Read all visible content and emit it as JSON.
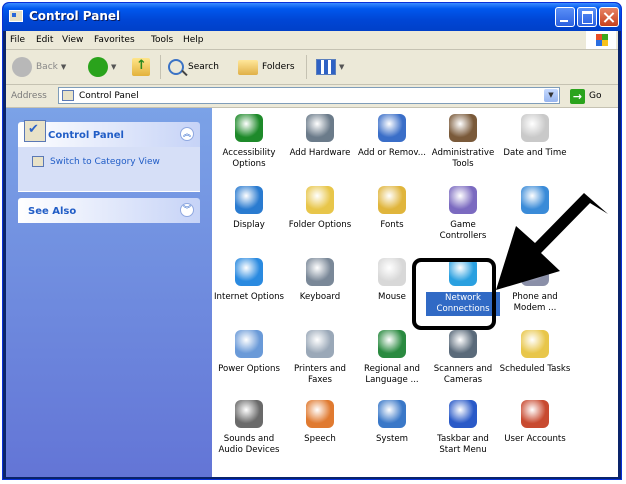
{
  "window": {
    "title": "Control Panel"
  },
  "menu": [
    "File",
    "Edit",
    "View",
    "Favorites",
    "Tools",
    "Help"
  ],
  "toolbar": {
    "back_label": "Back",
    "search_label": "Search",
    "folders_label": "Folders"
  },
  "address": {
    "label": "Address",
    "value": "Control Panel",
    "go_label": "Go"
  },
  "taskpane": {
    "control_panel_title": "Control Panel",
    "switch_link": "Switch to Category View",
    "see_also_title": "See Also"
  },
  "items": [
    {
      "label": "Accessibility Options",
      "icon": "accessibility-icon"
    },
    {
      "label": "Add Hardware",
      "icon": "add-hardware-icon"
    },
    {
      "label": "Add or Remov...",
      "icon": "add-remove-icon"
    },
    {
      "label": "Administrative Tools",
      "icon": "administrative-tools-icon"
    },
    {
      "label": "Date and Time",
      "icon": "date-time-icon"
    },
    {
      "label": "Display",
      "icon": "display-icon"
    },
    {
      "label": "Folder Options",
      "icon": "folder-options-icon"
    },
    {
      "label": "Fonts",
      "icon": "fonts-icon"
    },
    {
      "label": "Game Controllers",
      "icon": "game-controllers-icon"
    },
    {
      "label": "",
      "icon": "internet-options-partial-icon"
    },
    {
      "label": "Internet Options",
      "icon": "internet-options-icon"
    },
    {
      "label": "Keyboard",
      "icon": "keyboard-icon"
    },
    {
      "label": "Mouse",
      "icon": "mouse-icon"
    },
    {
      "label": "Network Connections",
      "icon": "network-connections-icon",
      "selected": true
    },
    {
      "label": "Phone and Modem ...",
      "icon": "phone-modem-icon"
    },
    {
      "label": "Power Options",
      "icon": "power-options-icon"
    },
    {
      "label": "Printers and Faxes",
      "icon": "printers-faxes-icon"
    },
    {
      "label": "Regional and Language ...",
      "icon": "regional-language-icon"
    },
    {
      "label": "Scanners and Cameras",
      "icon": "scanners-cameras-icon"
    },
    {
      "label": "Scheduled Tasks",
      "icon": "scheduled-tasks-icon"
    },
    {
      "label": "Sounds and Audio Devices",
      "icon": "sounds-audio-icon"
    },
    {
      "label": "Speech",
      "icon": "speech-icon"
    },
    {
      "label": "System",
      "icon": "system-icon"
    },
    {
      "label": "Taskbar and Start Menu",
      "icon": "taskbar-start-icon"
    },
    {
      "label": "User Accounts",
      "icon": "user-accounts-icon"
    }
  ],
  "colors": {
    "titlebar": "#0058ee",
    "taskpane": "#6375d6",
    "selection": "#316ac5"
  }
}
